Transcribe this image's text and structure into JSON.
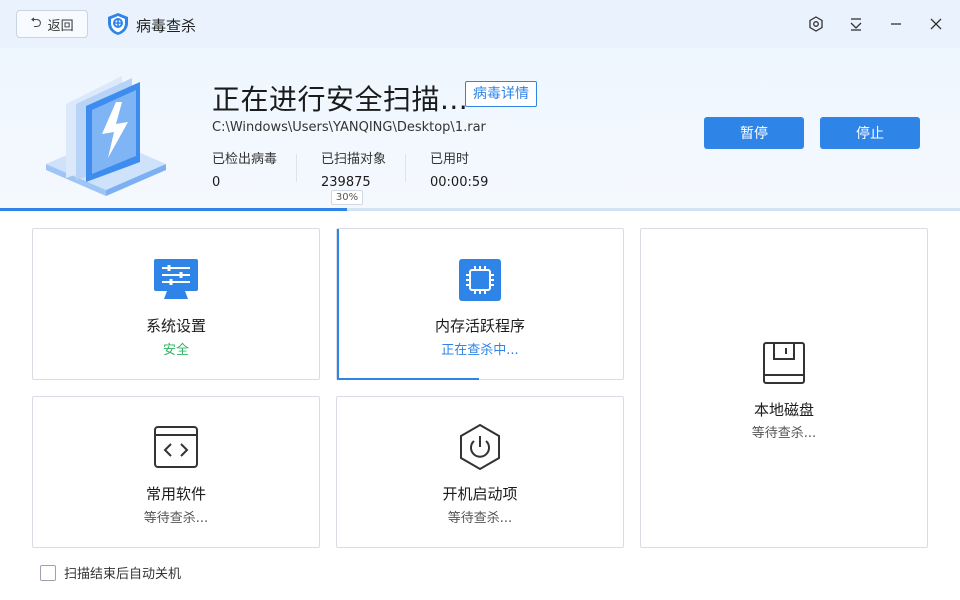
{
  "titlebar": {
    "back_label": "返回",
    "app_title": "病毒查杀",
    "icons": [
      "settings-icon",
      "dropdown-icon",
      "minimize-icon",
      "close-icon"
    ]
  },
  "scan": {
    "title": "正在进行安全扫描...",
    "detail_link": "病毒详情",
    "path": "C:\\Windows\\Users\\YANQING\\Desktop\\1.rar",
    "stats": [
      {
        "label": "已检出病毒",
        "value": "0"
      },
      {
        "label": "已扫描对象",
        "value": "239875"
      },
      {
        "label": "已用时",
        "value": "00:00:59"
      }
    ],
    "pause_label": "暂停",
    "stop_label": "停止",
    "progress_percent": 30,
    "progress_label": "30%"
  },
  "cards": [
    {
      "title": "系统设置",
      "status": "安全",
      "status_color": "#2fb463",
      "icon": "monitor-sliders-icon"
    },
    {
      "title": "内存活跃程序",
      "status": "正在查杀中...",
      "status_color": "#2f84e8",
      "icon": "chip-icon"
    },
    {
      "title": "本地磁盘",
      "status": "等待查杀...",
      "status_color": "#555555",
      "icon": "disk-icon"
    },
    {
      "title": "常用软件",
      "status": "等待查杀...",
      "status_color": "#555555",
      "icon": "code-window-icon"
    },
    {
      "title": "开机启动项",
      "status": "等待查杀...",
      "status_color": "#555555",
      "icon": "power-hexagon-icon"
    }
  ],
  "footer": {
    "auto_shutdown_label": "扫描结束后自动关机",
    "auto_shutdown_checked": false
  },
  "colors": {
    "accent": "#2f84e8",
    "safe": "#2fb463",
    "titlebar_bg": "#eaf3fd"
  }
}
